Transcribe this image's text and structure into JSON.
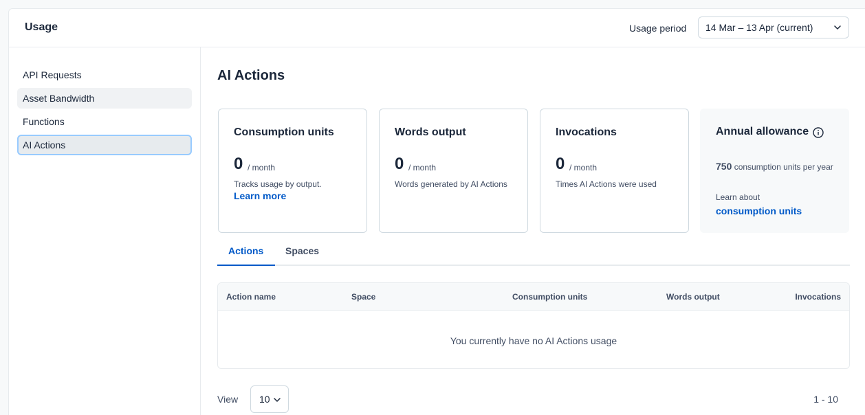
{
  "header": {
    "title": "Usage",
    "period_label": "Usage period",
    "period_value": "14 Mar – 13 Apr (current)"
  },
  "sidebar": {
    "items": [
      {
        "label": "API Requests"
      },
      {
        "label": "Asset Bandwidth"
      },
      {
        "label": "Functions"
      },
      {
        "label": "AI Actions"
      }
    ]
  },
  "main": {
    "title": "AI Actions",
    "cards": [
      {
        "title": "Consumption units",
        "value": "0",
        "unit": "/ month",
        "desc": "Tracks usage by output.",
        "link": "Learn more"
      },
      {
        "title": "Words output",
        "value": "0",
        "unit": "/ month",
        "desc": "Words generated by AI Actions"
      },
      {
        "title": "Invocations",
        "value": "0",
        "unit": "/ month",
        "desc": "Times AI Actions were used"
      }
    ],
    "allowance": {
      "title": "Annual allowance",
      "amount": "750",
      "amount_text": "consumption units per year",
      "learn_text": "Learn about",
      "link": "consumption units"
    },
    "tabs": [
      {
        "label": "Actions"
      },
      {
        "label": "Spaces"
      }
    ],
    "table": {
      "columns": [
        "Action name",
        "Space",
        "Consumption units",
        "Words output",
        "Invocations"
      ],
      "empty_message": "You currently have no AI Actions usage"
    },
    "pagination": {
      "view_label": "View",
      "page_size": "10",
      "range": "1 - 10"
    }
  },
  "colors": {
    "accent": "#0059c8",
    "active_border": "#98cbff",
    "text": "#1b273a",
    "muted": "#414d63"
  }
}
